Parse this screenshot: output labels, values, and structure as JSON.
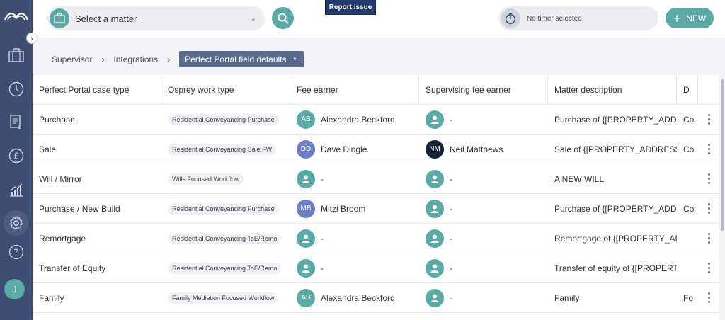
{
  "topbar": {
    "matter_placeholder": "Select a matter",
    "report_issue_label": "Report issue",
    "timer_label": "No timer selected",
    "new_label": "NEW"
  },
  "sidebar": {
    "avatar_initial": "J",
    "items": [
      {
        "icon": "briefcase-icon"
      },
      {
        "icon": "clock-icon"
      },
      {
        "icon": "invoice-icon"
      },
      {
        "icon": "pound-icon"
      },
      {
        "icon": "chart-icon"
      },
      {
        "icon": "gear-icon",
        "active": true
      },
      {
        "icon": "help-icon"
      }
    ]
  },
  "breadcrumb": {
    "items": [
      "Supervisor",
      "Integrations"
    ],
    "current": "Perfect Portal field defaults"
  },
  "table": {
    "columns": [
      "Perfect Portal case type",
      "Osprey work type",
      "Fee earner",
      "Supervising fee earner",
      "Matter description",
      "D"
    ],
    "rows": [
      {
        "case_type": "Purchase",
        "work_type": "Residential Conveyancing Purchase",
        "fee_earner": {
          "initials": "AB",
          "name": "Alexandra Beckford",
          "color": "teal"
        },
        "supervisor": {
          "initials": "",
          "name": "-",
          "color": "teal"
        },
        "description": "Purchase of {[PROPERTY_ADDR",
        "extra": "Co"
      },
      {
        "case_type": "Sale",
        "work_type": "Residential Conveyancing Sale FW",
        "fee_earner": {
          "initials": "DD",
          "name": "Dave Dingle",
          "color": "blue"
        },
        "supervisor": {
          "initials": "NM",
          "name": "Neil Matthews",
          "color": "dark"
        },
        "description": "Sale of {[PROPERTY_ADDRESS]}",
        "extra": "Co"
      },
      {
        "case_type": "Will / Mirror",
        "work_type": "Wills Focused Workflow",
        "fee_earner": {
          "initials": "",
          "name": "-",
          "color": "teal"
        },
        "supervisor": {
          "initials": "",
          "name": "-",
          "color": "teal"
        },
        "description": "A NEW WILL",
        "extra": ""
      },
      {
        "case_type": "Purchase / New Build",
        "work_type": "Residential Conveyancing Purchase",
        "fee_earner": {
          "initials": "MB",
          "name": "Mitzi Broom",
          "color": "blue"
        },
        "supervisor": {
          "initials": "",
          "name": "-",
          "color": "teal"
        },
        "description": "Purchase of {[PROPERTY_ADDR",
        "extra": "Co"
      },
      {
        "case_type": "Remortgage",
        "work_type": "Residential Conveyancing ToE/Remo",
        "fee_earner": {
          "initials": "",
          "name": "-",
          "color": "teal"
        },
        "supervisor": {
          "initials": "",
          "name": "-",
          "color": "teal"
        },
        "description": "Remortgage of {[PROPERTY_AD",
        "extra": ""
      },
      {
        "case_type": "Transfer of Equity",
        "work_type": "Residential Conveyancing ToE/Remo",
        "fee_earner": {
          "initials": "",
          "name": "-",
          "color": "teal"
        },
        "supervisor": {
          "initials": "",
          "name": "-",
          "color": "teal"
        },
        "description": "Transfer of equity of {[PROPERTY",
        "extra": ""
      },
      {
        "case_type": "Family",
        "work_type": "Family Mediation Focused Workflow",
        "fee_earner": {
          "initials": "AB",
          "name": "Alexandra Beckford",
          "color": "teal"
        },
        "supervisor": {
          "initials": "",
          "name": "-",
          "color": "teal"
        },
        "description": "Family",
        "extra": "Fo"
      }
    ]
  },
  "colors": {
    "sidebar": "#3d4e72",
    "accent": "#5aaaa8",
    "report_issue": "#243b6b",
    "breadcrumb_current": "#5a6a8a"
  }
}
